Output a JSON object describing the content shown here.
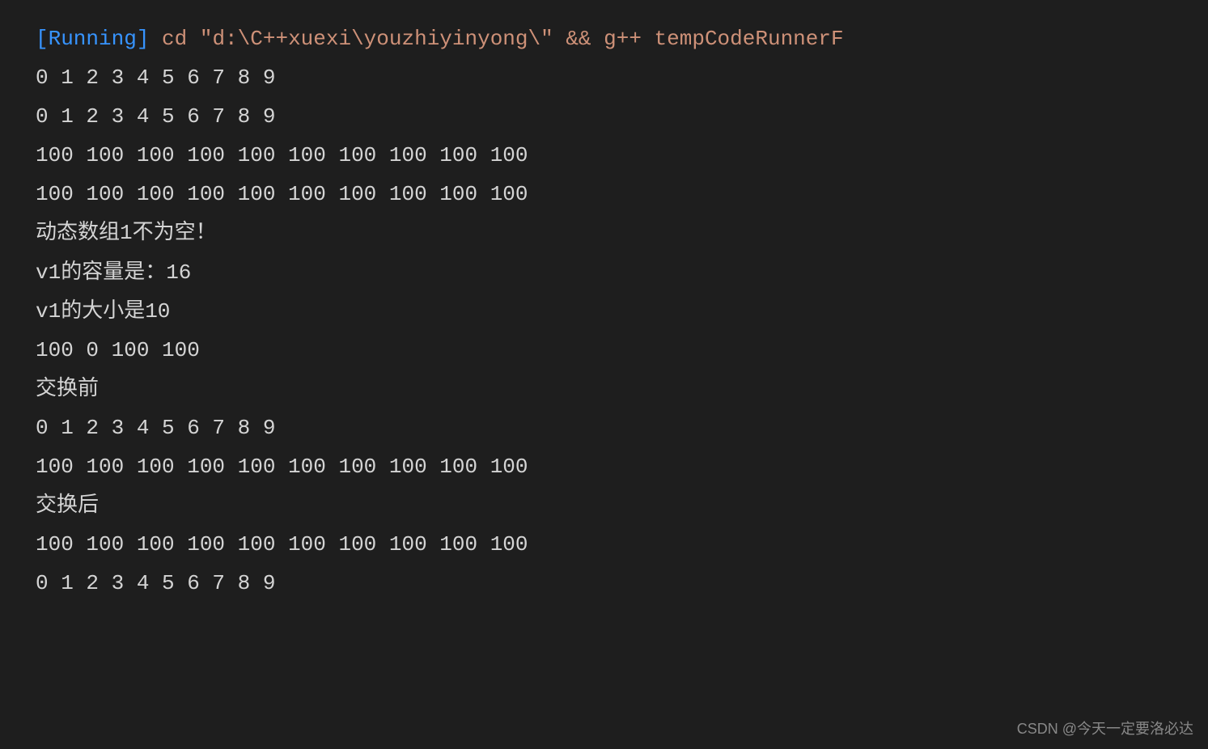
{
  "terminal": {
    "status": "[Running]",
    "command": " cd \"d:\\C++xuexi\\youzhiyinyong\\\" && g++ tempCodeRunnerF",
    "lines": [
      "0 1 2 3 4 5 6 7 8 9 ",
      "0 1 2 3 4 5 6 7 8 9 ",
      "100 100 100 100 100 100 100 100 100 100 ",
      "100 100 100 100 100 100 100 100 100 100 ",
      "动态数组1不为空！",
      "v1的容量是：16",
      "v1的大小是10",
      "100 0 100 100 ",
      "交换前",
      "0 1 2 3 4 5 6 7 8 9 ",
      "100 100 100 100 100 100 100 100 100 100 ",
      "交换后",
      "100 100 100 100 100 100 100 100 100 100 ",
      "0 1 2 3 4 5 6 7 8 9 "
    ]
  },
  "watermark": "CSDN @今天一定要洛必达"
}
